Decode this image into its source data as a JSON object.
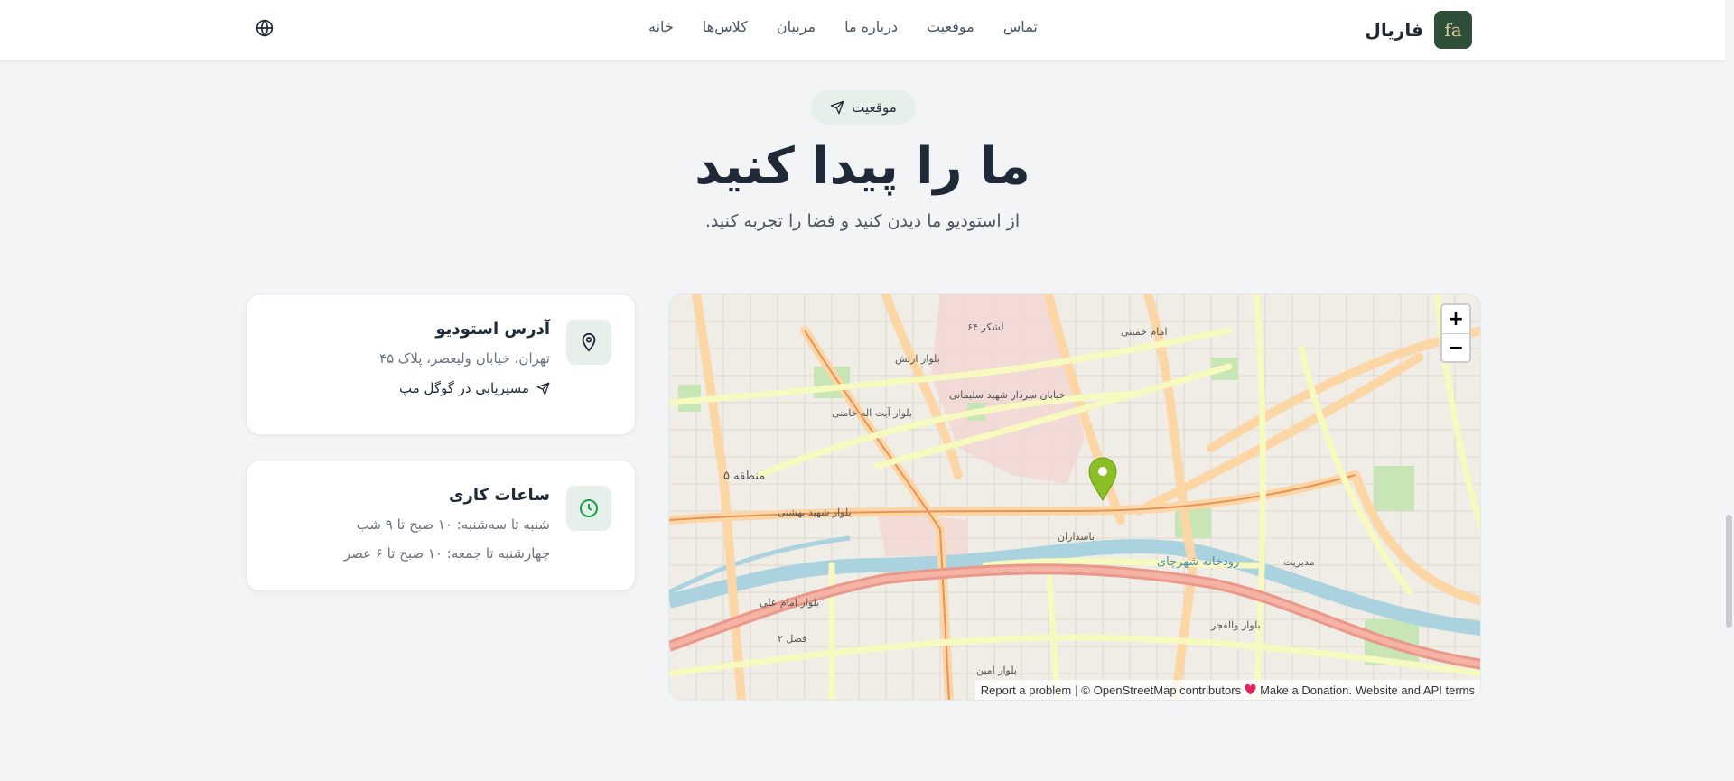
{
  "header": {
    "brand_name": "فاریال",
    "logo_letters": "fa",
    "nav": [
      "خانه",
      "کلاس‌ها",
      "مربیان",
      "درباره ما",
      "موقعیت",
      "تماس"
    ]
  },
  "hero": {
    "badge": "موقعیت",
    "title": "ما را پیدا کنید",
    "subtitle": "از استودیو ما دیدن کنید و فضا را تجربه کنید."
  },
  "address_card": {
    "title": "آدرس استودیو",
    "address": "تهران، خیابان ولیعصر، پلاک ۴۵",
    "directions_label": "مسیریابی در گوگل مپ"
  },
  "hours_card": {
    "title": "ساعات کاری",
    "line1": "شنبه تا سه‌شنبه: ۱۰ صبح تا ۹ شب",
    "line2": "چهارشنبه تا جمعه: ۱۰ صبح تا ۶ عصر"
  },
  "map": {
    "zoom_in": "+",
    "zoom_out": "−",
    "attr_report": "Report a problem",
    "attr_sep": "| ©",
    "attr_osm": "OpenStreetMap contributors",
    "attr_donate": "Make a Donation.",
    "attr_terms": "Website and API terms",
    "labels": {
      "l1": "بلوار شهید بهشتی",
      "l2": "بلوار آیت اله خامنی",
      "l3": "خیابان سردار شهید سلیمانی",
      "l4": "منطقه ۵",
      "l5": "رودخانه شهرچای",
      "l6": "بلوار امام علی",
      "l7": "بلوار والفجر",
      "l8": "باسداران",
      "l9": "لشکر ۶۴",
      "l10": "بلوار ارتش",
      "l11": "امام خمینی",
      "l12": "مدیریت",
      "l13": "فصل ۲",
      "l14": "بلوار امین"
    }
  },
  "colors": {
    "accent": "#2f4f3a",
    "accent_soft": "#e6efe9",
    "icon_green": "#16a34a",
    "marker": "#8cbf26"
  },
  "icons": {
    "language": "globe-icon",
    "badge": "navigation-arrow-icon",
    "address": "map-pin-icon",
    "hours": "clock-icon",
    "directions": "navigation-arrow-icon",
    "marker": "map-marker-icon",
    "donate": "heart-icon"
  }
}
